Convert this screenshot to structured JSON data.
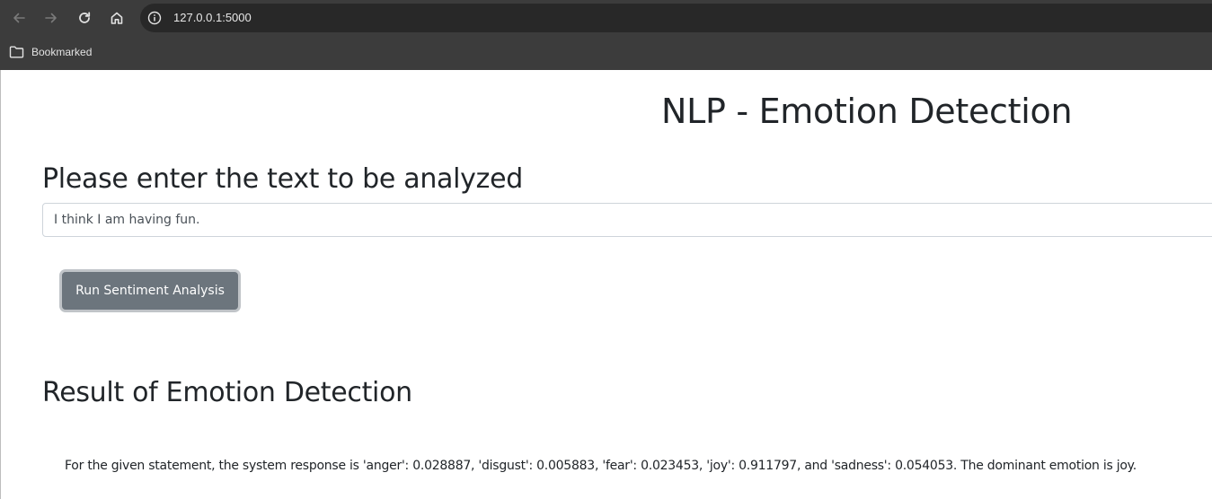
{
  "browser": {
    "url": "127.0.0.1:5000",
    "bookmarks": [
      {
        "label": "Bookmarked",
        "icon": "folder-icon"
      }
    ],
    "icons": {
      "back": "arrow-left-icon",
      "forward": "arrow-right-icon",
      "reload": "reload-icon",
      "home": "home-icon",
      "site_info": "info-icon"
    },
    "colors": {
      "toolbar": "#3c3c3c",
      "omnibox": "#282828"
    }
  },
  "page": {
    "title": "NLP - Emotion Detection",
    "input_heading": "Please enter the text to be analyzed",
    "input_value": "I think I am having fun.",
    "button_label": "Run Sentiment Analysis",
    "result_heading": "Result of Emotion Detection",
    "result_text": "For the given statement, the system response is 'anger': 0.028887, 'disgust': 0.005883, 'fear': 0.023453, 'joy': 0.911797, and 'sadness': 0.054053. The dominant emotion is joy.",
    "colors": {
      "text": "#212529",
      "button_bg": "#6c757d",
      "input_border": "#ced4da"
    }
  }
}
